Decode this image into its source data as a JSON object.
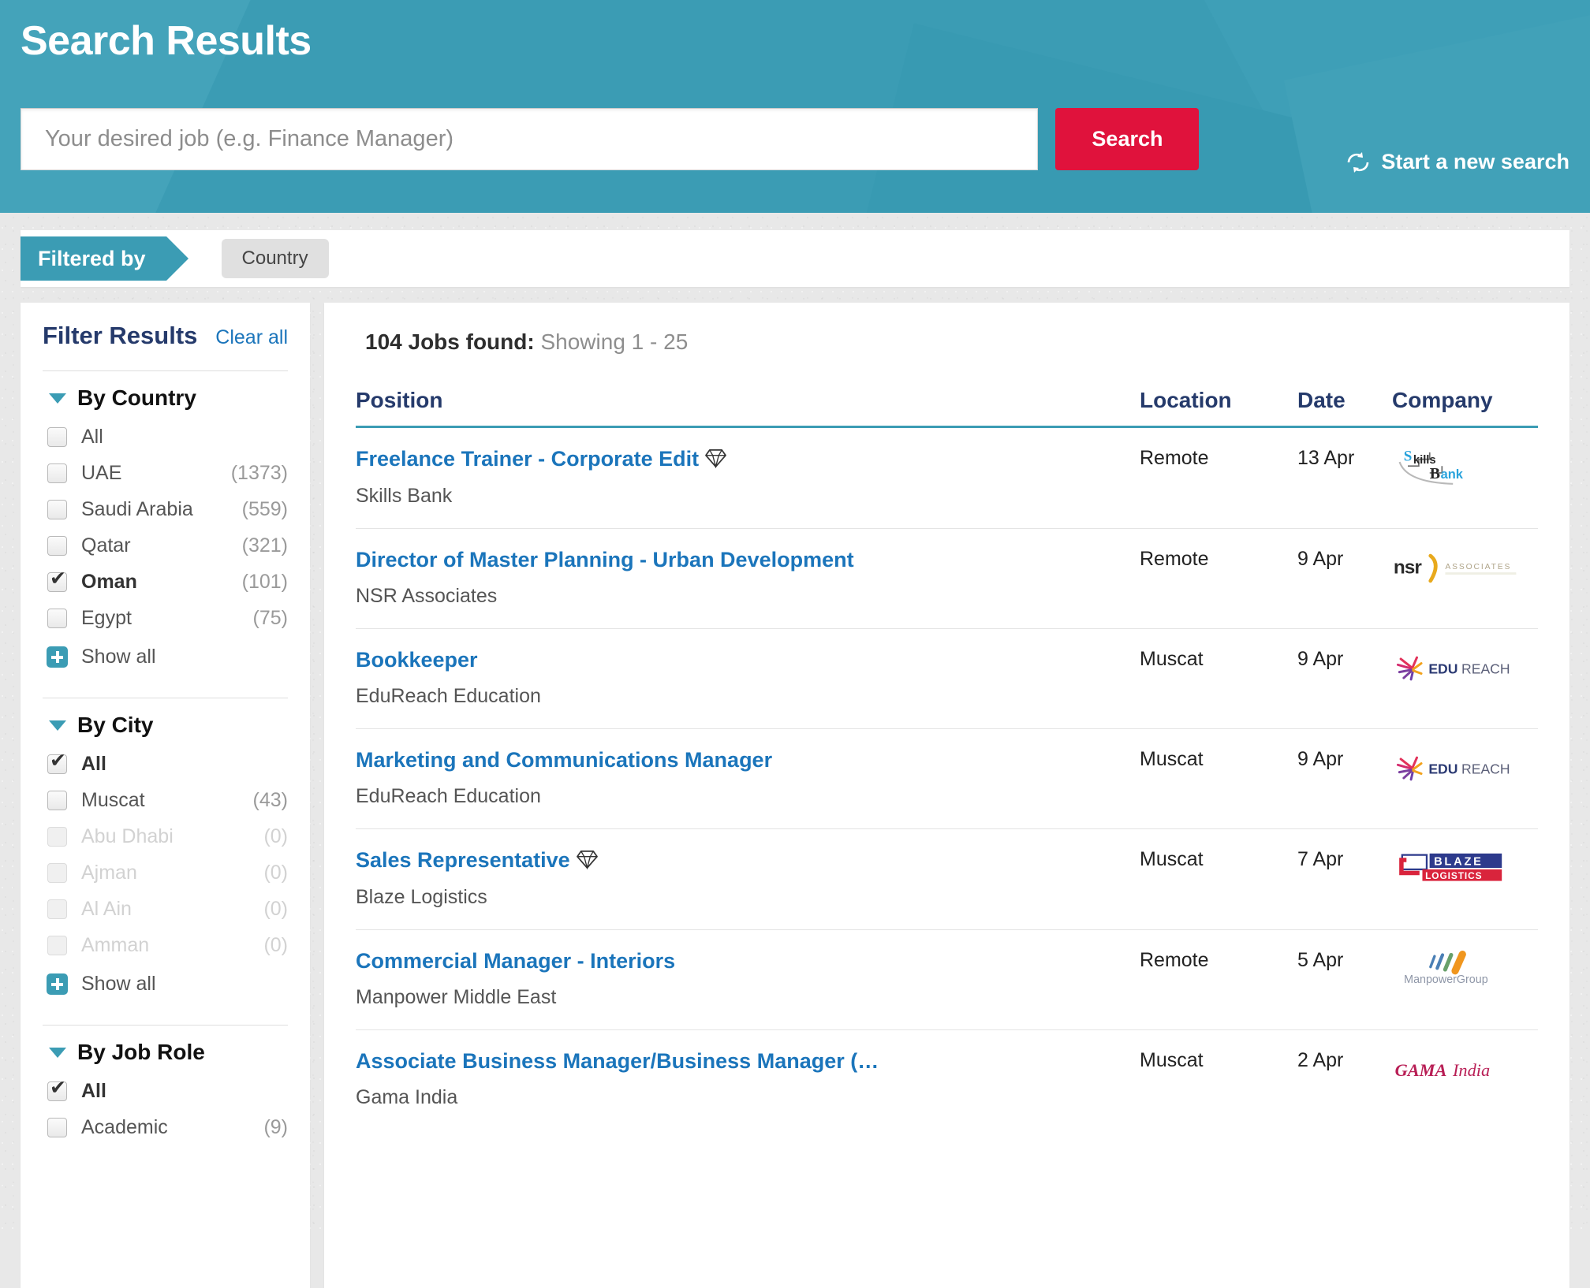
{
  "header": {
    "title": "Search Results",
    "search_placeholder": "Your desired job (e.g. Finance Manager)",
    "search_value": "",
    "search_button": "Search",
    "new_search_label": "Start a new search",
    "new_search_icon": "refresh-icon",
    "brand_color": "#3b9cb4",
    "search_button_color": "#e0123c"
  },
  "filtered_by": {
    "label": "Filtered by",
    "chips": [
      "Country"
    ]
  },
  "sidebar": {
    "title": "Filter Results",
    "clear_all": "Clear all",
    "groups": [
      {
        "name": "By Country",
        "expanded": true,
        "options": [
          {
            "label": "All",
            "count": "",
            "checked": false,
            "disabled": false
          },
          {
            "label": "UAE",
            "count": "(1373)",
            "checked": false,
            "disabled": false
          },
          {
            "label": "Saudi Arabia",
            "count": "(559)",
            "checked": false,
            "disabled": false
          },
          {
            "label": "Qatar",
            "count": "(321)",
            "checked": false,
            "disabled": false
          },
          {
            "label": "Oman",
            "count": "(101)",
            "checked": true,
            "disabled": false
          },
          {
            "label": "Egypt",
            "count": "(75)",
            "checked": false,
            "disabled": false
          }
        ],
        "show_all": "Show all"
      },
      {
        "name": "By City",
        "expanded": true,
        "options": [
          {
            "label": "All",
            "count": "",
            "checked": true,
            "disabled": false
          },
          {
            "label": "Muscat",
            "count": "(43)",
            "checked": false,
            "disabled": false
          },
          {
            "label": "Abu Dhabi",
            "count": "(0)",
            "checked": false,
            "disabled": true
          },
          {
            "label": "Ajman",
            "count": "(0)",
            "checked": false,
            "disabled": true
          },
          {
            "label": "Al Ain",
            "count": "(0)",
            "checked": false,
            "disabled": true
          },
          {
            "label": "Amman",
            "count": "(0)",
            "checked": false,
            "disabled": true
          }
        ],
        "show_all": "Show all"
      },
      {
        "name": "By Job Role",
        "expanded": true,
        "options": [
          {
            "label": "All",
            "count": "",
            "checked": true,
            "disabled": false
          },
          {
            "label": "Academic",
            "count": "(9)",
            "checked": false,
            "disabled": false
          }
        ],
        "show_all": ""
      }
    ]
  },
  "results": {
    "count_text": "104 Jobs found:",
    "showing_text": "Showing 1 - 25",
    "columns": [
      "Position",
      "Location",
      "Date",
      "Company"
    ],
    "rows": [
      {
        "position": "Freelance Trainer - Corporate Edit",
        "premium": true,
        "company": "Skills Bank",
        "location": "Remote",
        "date": "13 Apr",
        "logo": "skills-bank-logo"
      },
      {
        "position": "Director of Master Planning - Urban Development",
        "premium": false,
        "company": "NSR Associates",
        "location": "Remote",
        "date": "9 Apr",
        "logo": "nsr-associates-logo"
      },
      {
        "position": "Bookkeeper",
        "premium": false,
        "company": "EduReach Education",
        "location": "Muscat",
        "date": "9 Apr",
        "logo": "edureach-logo"
      },
      {
        "position": "Marketing and Communications Manager",
        "premium": false,
        "company": "EduReach Education",
        "location": "Muscat",
        "date": "9 Apr",
        "logo": "edureach-logo"
      },
      {
        "position": "Sales Representative",
        "premium": true,
        "company": "Blaze Logistics",
        "location": "Muscat",
        "date": "7 Apr",
        "logo": "blaze-logistics-logo"
      },
      {
        "position": "Commercial Manager - Interiors",
        "premium": false,
        "company": "Manpower Middle East",
        "location": "Remote",
        "date": "5 Apr",
        "logo": "manpowergroup-logo"
      },
      {
        "position": "Associate Business Manager/Business Manager (…",
        "premium": false,
        "company": "Gama India",
        "location": "Muscat",
        "date": "2 Apr",
        "logo": "gama-india-logo"
      }
    ]
  }
}
